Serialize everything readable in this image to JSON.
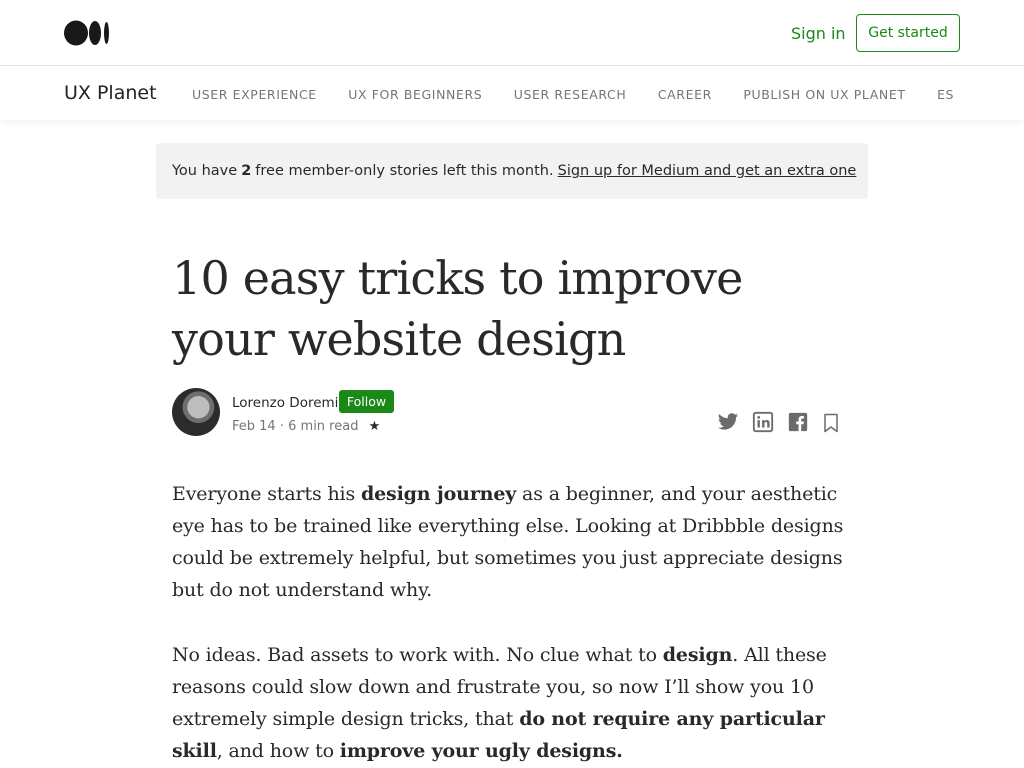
{
  "topbar": {
    "logo": "medium-logo",
    "signin_label": "Sign in",
    "getstarted_label": "Get started"
  },
  "publication": {
    "name": "UX Planet",
    "nav": [
      "USER EXPERIENCE",
      "UX FOR BEGINNERS",
      "USER RESEARCH",
      "CAREER",
      "PUBLISH ON UX PLANET",
      "ES"
    ]
  },
  "banner": {
    "prefix": "You have",
    "count": "2",
    "suffix": "free member-only stories left this month.",
    "link": "Sign up for Medium and get an extra one"
  },
  "article": {
    "title": "10 easy tricks to improve your website design",
    "author": "Lorenzo Doremi",
    "follow_label": "Follow",
    "date": "Feb 14",
    "separator": "·",
    "read_time": "6 min read",
    "star": "★",
    "paragraph1": [
      {
        "t": "Everyone starts his ",
        "b": false
      },
      {
        "t": "design journey",
        "b": true
      },
      {
        "t": " as a beginner, and your aesthetic eye has to be trained like everything else. Looking at Dribbble designs could be extremely helpful, but sometimes you just appreciate designs but do not understand why.",
        "b": false
      }
    ],
    "paragraph2": [
      {
        "t": "No ideas. Bad assets to work with. No clue what to ",
        "b": false
      },
      {
        "t": "design",
        "b": true
      },
      {
        "t": ". All these reasons could slow down and frustrate you, so now I’ll show you 10 extremely simple design tricks, that ",
        "b": false
      },
      {
        "t": "do not require any particular skill",
        "b": true
      },
      {
        "t": ", and how to ",
        "b": false
      },
      {
        "t": "improve your ugly designs.",
        "b": true
      }
    ]
  },
  "share_icons": [
    "twitter-icon",
    "linkedin-icon",
    "facebook-icon",
    "bookmark-icon"
  ],
  "colors": {
    "accent": "#1a8917",
    "text": "#292929",
    "muted": "#757575",
    "banner_bg": "#f2f2f2"
  }
}
